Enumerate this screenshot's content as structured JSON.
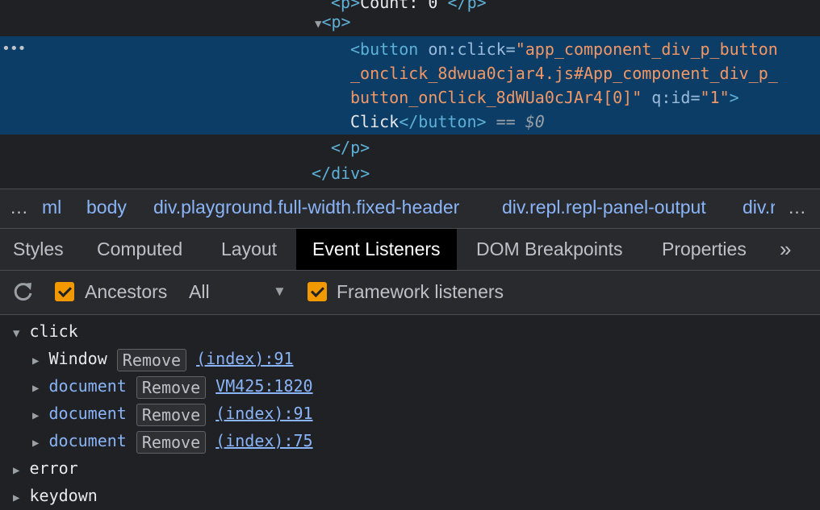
{
  "dom_tree": {
    "line0_text": "Count: 0 ",
    "p_open": "<p>",
    "btn_tag_open": "<button",
    "btn_attr_name": " on:click=",
    "btn_attr_val_1": "\"app_component_div_p_button",
    "btn_attr_val_2": "_onclick_8dwua0cjar4.js#App_component_div_p_",
    "btn_attr_val_3": "button_onClick_8dWUa0cJAr4[0]\"",
    "qid_name": " q:id=",
    "qid_val": "\"1\"",
    "tag_close_bracket": ">",
    "btn_text": "Click",
    "btn_close": "</button>",
    "eq_ref": " == $0",
    "p_close": "</p>",
    "div_close": "</div>",
    "ellipsis": "•••"
  },
  "breadcrumb": {
    "lead": "…",
    "items": [
      "ml",
      "body",
      "div.playground.full-width.fixed-header",
      "div.repl.repl-panel-output",
      "div.r"
    ],
    "more": "…"
  },
  "tabs": {
    "items": [
      "Styles",
      "Computed",
      "Layout",
      "Event Listeners",
      "DOM Breakpoints",
      "Properties"
    ],
    "active": "Event Listeners",
    "overflow": "»"
  },
  "toolbar": {
    "ancestors_label": "Ancestors",
    "ancestors_checked": true,
    "filter_value": "All",
    "framework_label": "Framework listeners",
    "framework_checked": true
  },
  "listeners": {
    "groups": [
      {
        "event": "click",
        "expanded": true,
        "entries": [
          {
            "node": "Window",
            "remove": "Remove",
            "source": "(index):91"
          },
          {
            "node": "document",
            "remove": "Remove",
            "source": "VM425:1820"
          },
          {
            "node": "document",
            "remove": "Remove",
            "source": "(index):91"
          },
          {
            "node": "document",
            "remove": "Remove",
            "source": "(index):75"
          }
        ]
      },
      {
        "event": "error",
        "expanded": false
      },
      {
        "event": "keydown",
        "expanded": false
      }
    ]
  },
  "colors": {
    "background": "#202124",
    "panel": "#292a2d",
    "selection": "#0b3d66",
    "tag": "#5db0d7",
    "attr_value": "#f29766",
    "link": "#8ab4f8",
    "checkbox": "#f29900"
  }
}
